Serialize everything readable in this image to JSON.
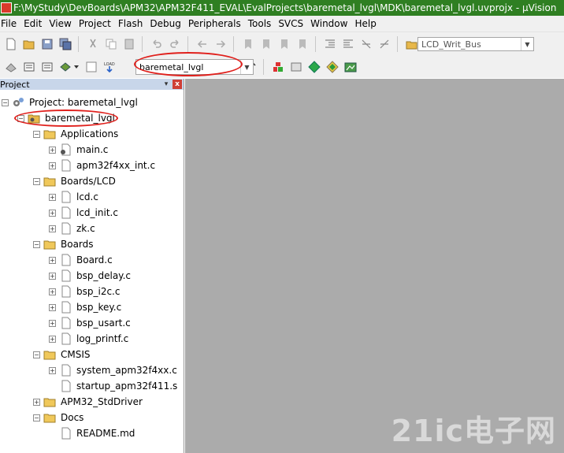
{
  "window": {
    "title": "F:\\MyStudy\\DevBoards\\APM32\\APM32F411_EVAL\\EvalProjects\\baremetal_lvgl\\MDK\\baremetal_lvgl.uvprojx - µVision"
  },
  "menubar": {
    "items": [
      "File",
      "Edit",
      "View",
      "Project",
      "Flash",
      "Debug",
      "Peripherals",
      "Tools",
      "SVCS",
      "Window",
      "Help"
    ]
  },
  "toolbar": {
    "function_combo": "LCD_Writ_Bus",
    "target_combo": "baremetal_lvgl"
  },
  "project_panel": {
    "title": "Project",
    "root": "Project: baremetal_lvgl",
    "target": "baremetal_lvgl",
    "groups": [
      {
        "name": "Applications",
        "files": [
          "main.c",
          "apm32f4xx_int.c"
        ]
      },
      {
        "name": "Boards/LCD",
        "files": [
          "lcd.c",
          "lcd_init.c",
          "zk.c"
        ]
      },
      {
        "name": "Boards",
        "files": [
          "Board.c",
          "bsp_delay.c",
          "bsp_i2c.c",
          "bsp_key.c",
          "bsp_usart.c",
          "log_printf.c"
        ]
      },
      {
        "name": "CMSIS",
        "files": [
          "system_apm32f4xx.c",
          "startup_apm32f411.s"
        ]
      },
      {
        "name": "APM32_StdDriver",
        "files": []
      },
      {
        "name": "Docs",
        "files": [
          "README.md"
        ]
      }
    ]
  },
  "watermark": "21ic电子网"
}
